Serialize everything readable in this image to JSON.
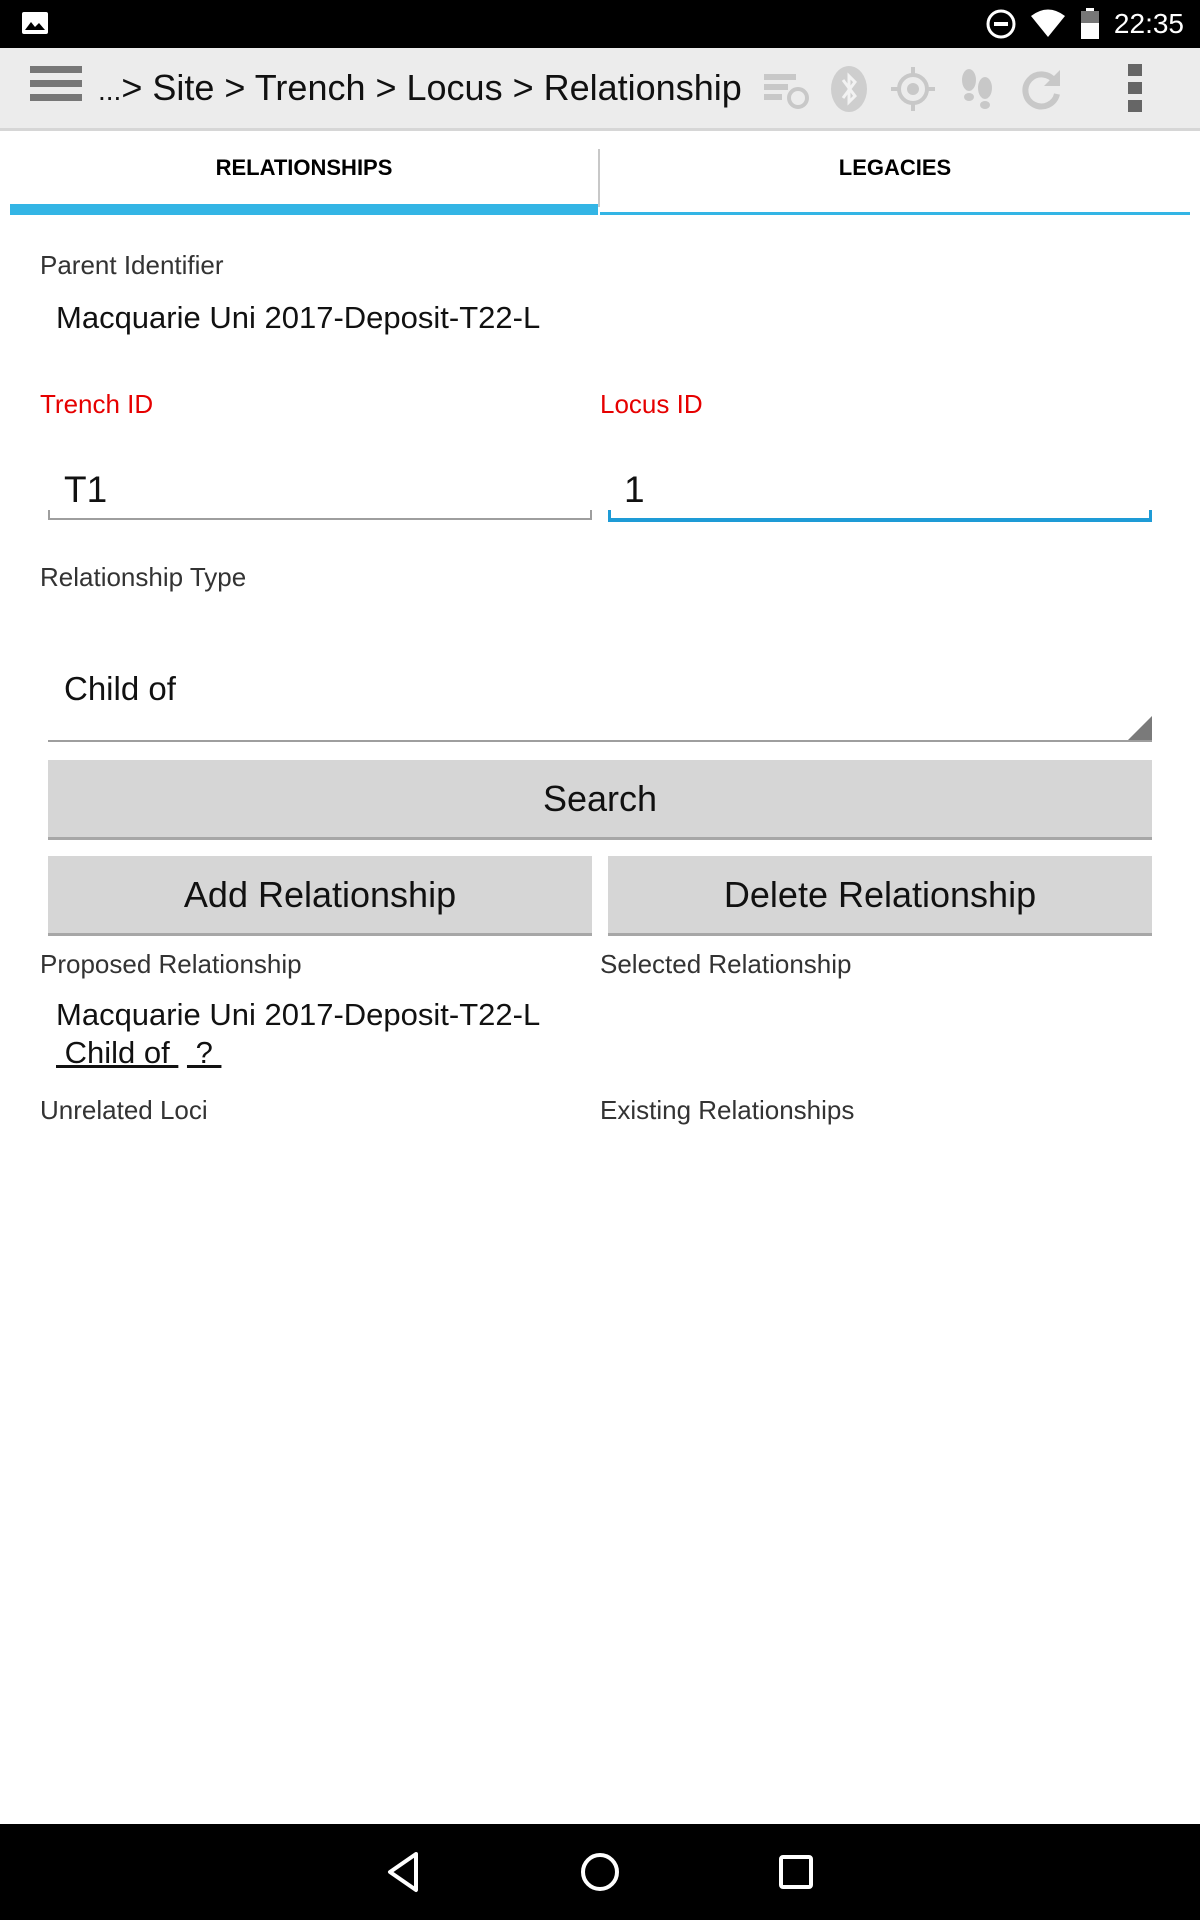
{
  "status_bar": {
    "time": "22:35",
    "icons": [
      "image-icon",
      "do-not-disturb-icon",
      "wifi-icon",
      "battery-icon"
    ]
  },
  "action_bar": {
    "breadcrumb_prefix": "...",
    "breadcrumb": "> Site > Trench > Locus > Relationship",
    "icons": [
      "sync-status-icon",
      "bluetooth-icon",
      "gps-icon",
      "tracking-icon",
      "refresh-icon",
      "overflow-menu-icon"
    ]
  },
  "tabs": [
    {
      "label": "RELATIONSHIPS",
      "active": true
    },
    {
      "label": "LEGACIES",
      "active": false
    }
  ],
  "form": {
    "parent_identifier_label": "Parent Identifier",
    "parent_identifier_value": "Macquarie Uni 2017-Deposit-T22-L",
    "trench_id_label": "Trench ID",
    "trench_id_value": "T1",
    "locus_id_label": "Locus ID",
    "locus_id_value": "1",
    "relationship_type_label": "Relationship Type",
    "relationship_type_value": "Child of",
    "search_button": "Search",
    "add_button": "Add Relationship",
    "delete_button": "Delete Relationship",
    "proposed_label": "Proposed Relationship",
    "selected_label": "Selected Relationship",
    "proposed_line1": "Macquarie Uni 2017-Deposit-T22-L",
    "proposed_type": " Child of ",
    "proposed_target": " ? ",
    "unrelated_label": "Unrelated Loci",
    "existing_label": "Existing Relationships"
  },
  "colors": {
    "accent": "#33b5e5",
    "focus": "#1e9bd6",
    "required_label": "#e60000",
    "button_bg": "#d6d6d6"
  }
}
